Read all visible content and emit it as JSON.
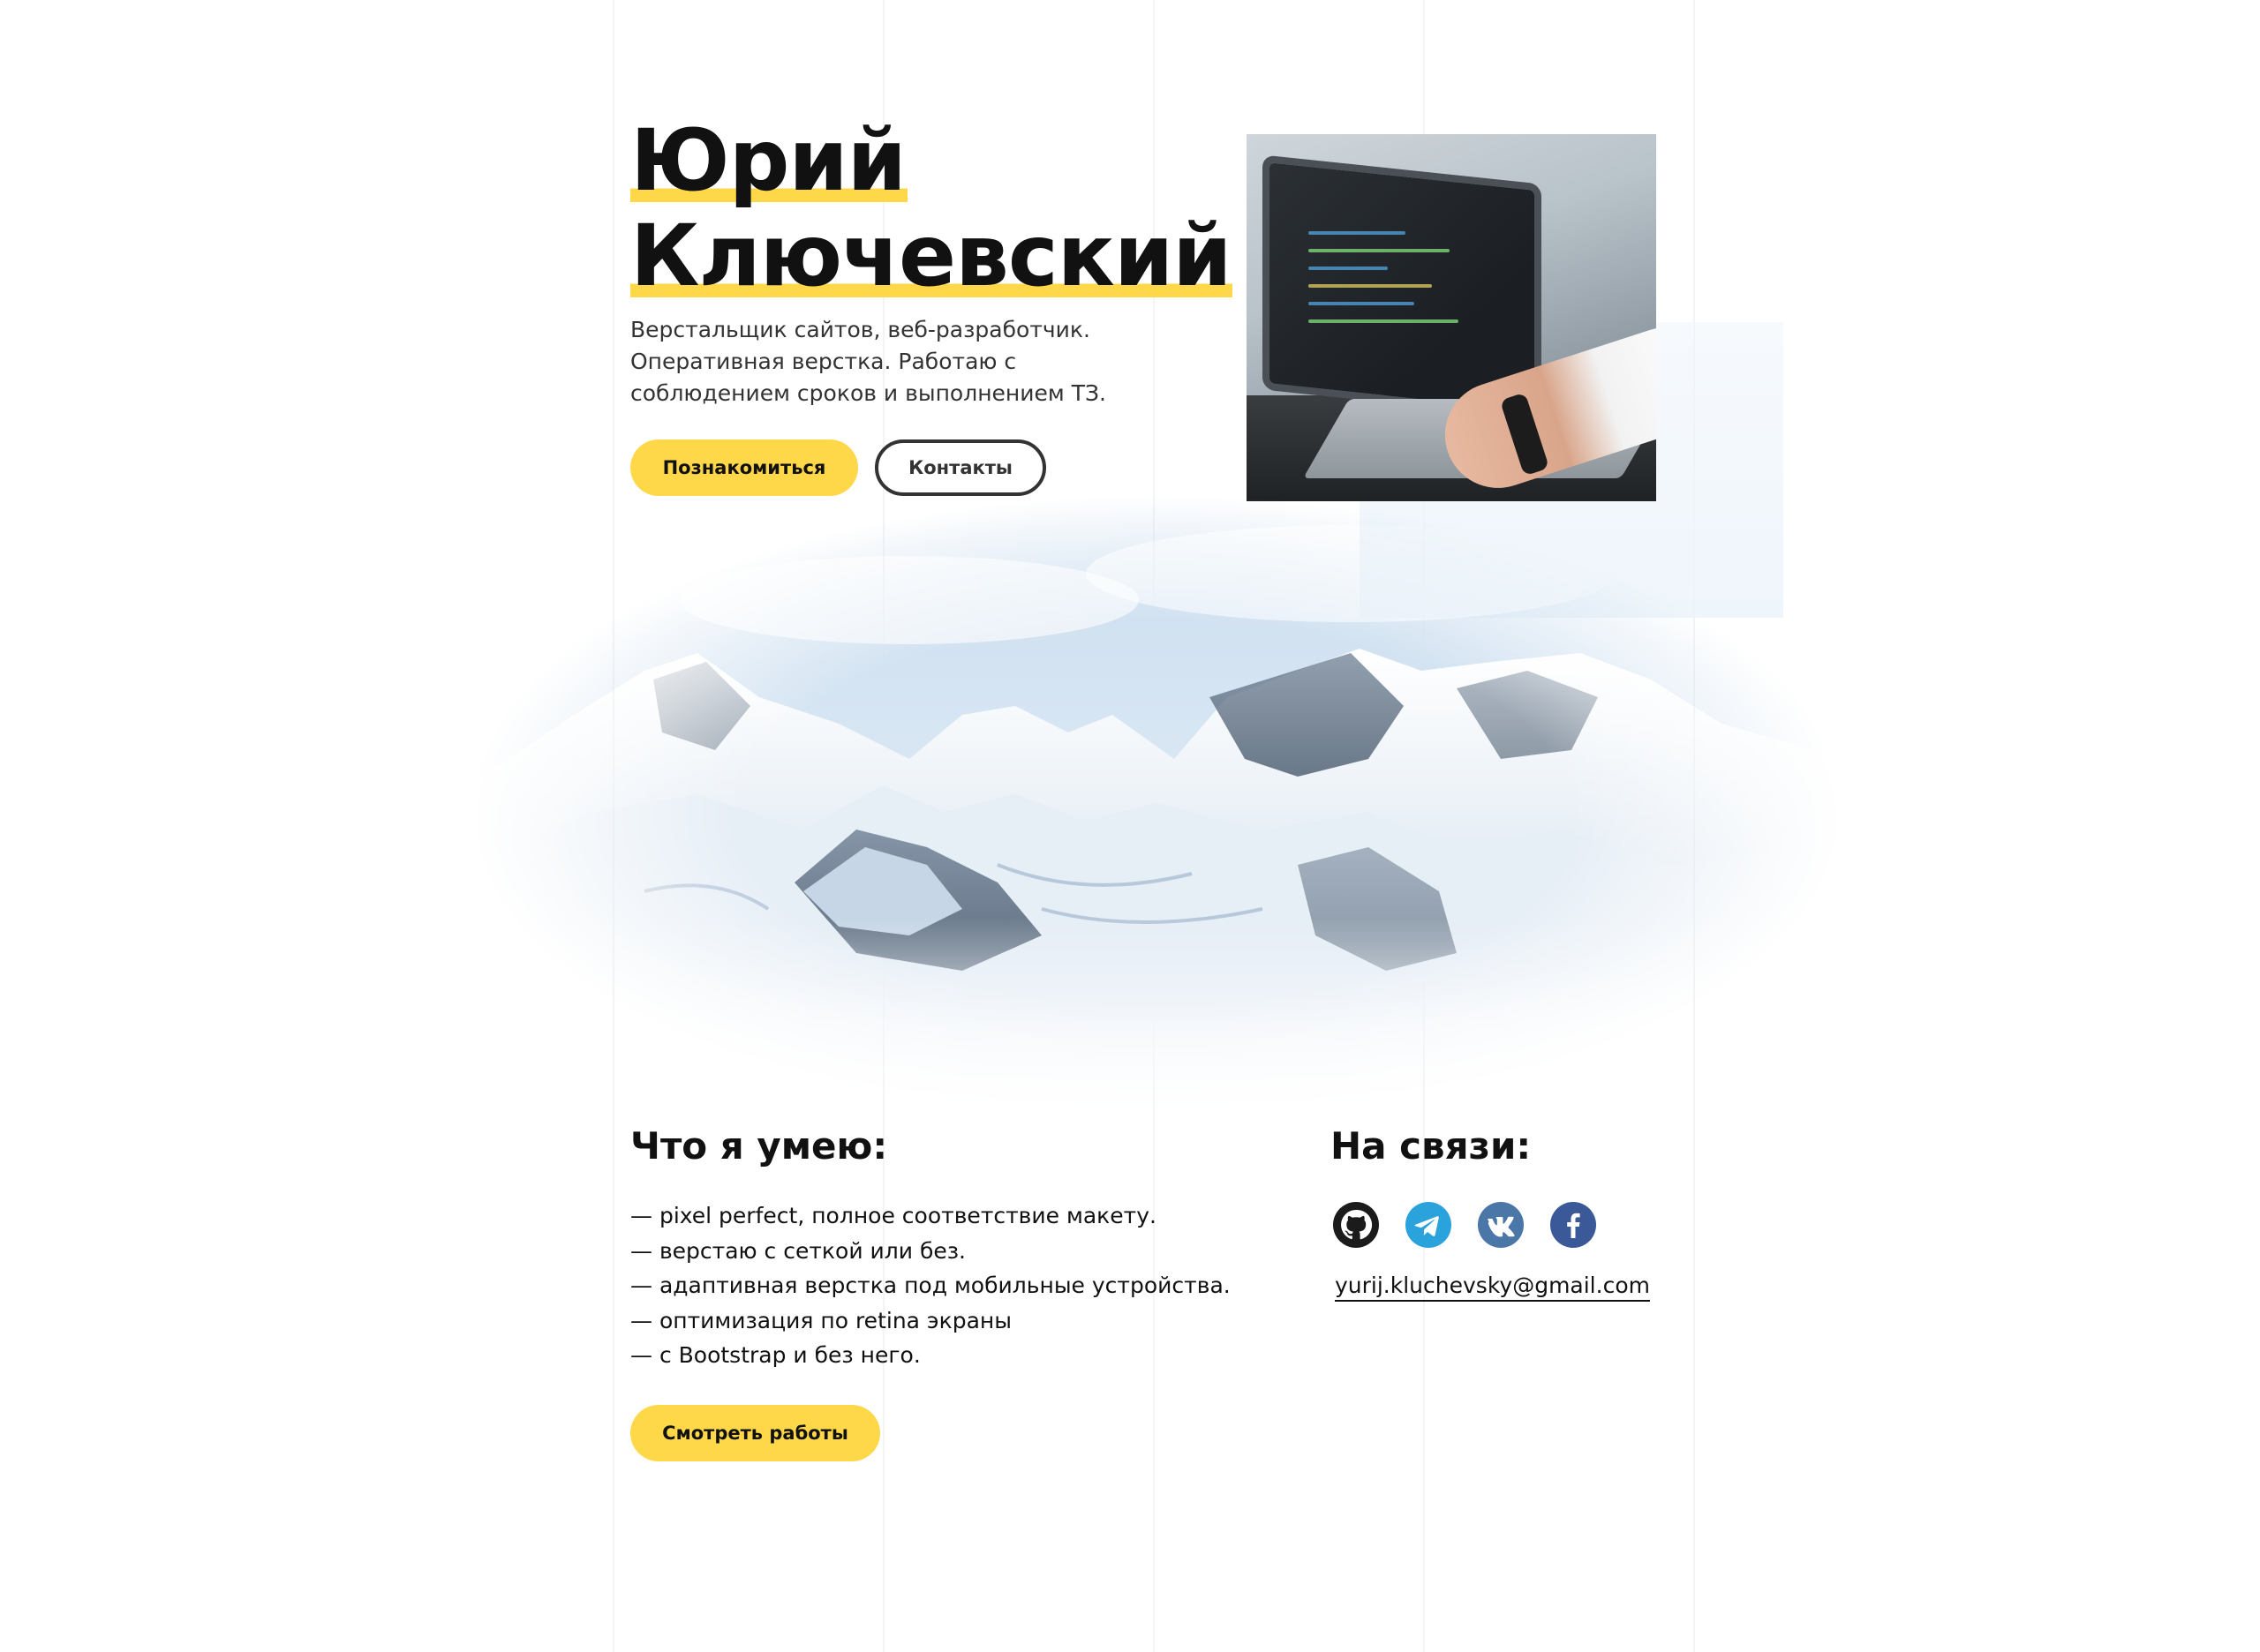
{
  "hero": {
    "first_name": "Юрий",
    "last_name": "Ключевский",
    "description": "Верстальщик сайтов, веб-разработчик. Оперативная верстка. Работаю с соблюдением сроков и выполнением ТЗ.",
    "buttons": {
      "meet": "Познакомиться",
      "contacts": "Контакты"
    }
  },
  "skills": {
    "title": "Что я умею:",
    "items": [
      "— pixel perfect, полное соответствие макету.",
      "— верстаю с сеткой или без.",
      "— адаптивная верстка под мобильные устройства.",
      "— оптимизация по retina экраны",
      "— с Bootstrap и без него."
    ],
    "button": "Смотреть работы"
  },
  "contacts": {
    "title": "На связи:",
    "socials": [
      "github-icon",
      "telegram-icon",
      "vk-icon",
      "facebook-icon"
    ],
    "email": "yurij.kluchevsky@gmail.com"
  },
  "colors": {
    "accent": "#ffd84a",
    "text": "#111111",
    "outline": "#333333",
    "telegram": "#2aa3dd",
    "vk": "#4a76a8",
    "facebook": "#3b5998"
  }
}
